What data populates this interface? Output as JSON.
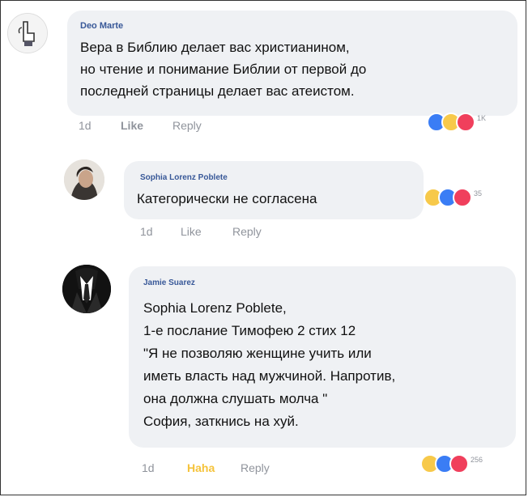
{
  "comments": [
    {
      "author": "Deo Marte",
      "text": "Вера в Библию делает вас христианином,\nно чтение и понимание Библии от первой до\nпоследней страницы делает вас атеистом.",
      "time": "1d",
      "like_label": "Like",
      "reply_label": "Reply",
      "reaction_count": "1K"
    },
    {
      "author": "Sophia Lorenz Poblete",
      "text": "Категорически не согласена",
      "time": "1d",
      "like_label": "Like",
      "reply_label": "Reply",
      "reaction_count": "35"
    },
    {
      "author": "Jamie Suarez",
      "text": "Sophia Lorenz Poblete,\n1-е послание Тимофею 2 стих 12\n\"Я не позволяю женщине учить или\nиметь власть над мужчиной. Напротив,\nона должна слушать молча \"\nСофия, заткнись на хуй.",
      "time": "1d",
      "haha_label": "Haha",
      "reply_label": "Reply",
      "reaction_count": "256"
    }
  ],
  "colors": {
    "bubble": "#eff1f4",
    "name": "#385898",
    "meta": "#90949c",
    "haha": "#f5c33b"
  }
}
